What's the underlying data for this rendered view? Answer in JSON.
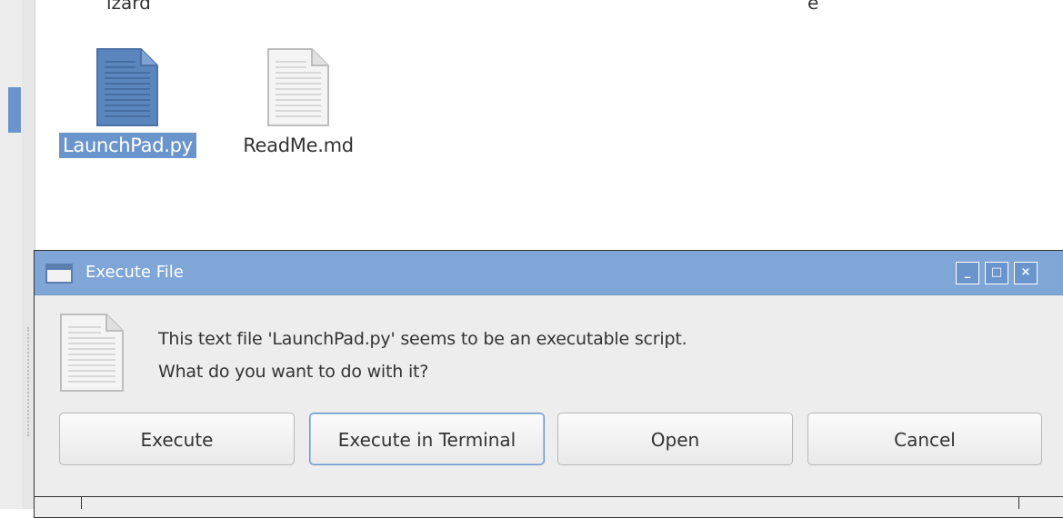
{
  "file_manager": {
    "truncated_labels": [
      "izard",
      "e"
    ],
    "files": [
      {
        "name": "LaunchPad.py",
        "selected": true,
        "icon": "text-file-icon"
      },
      {
        "name": "ReadMe.md",
        "selected": false,
        "icon": "text-file-icon"
      }
    ]
  },
  "dialog": {
    "title": "Execute File",
    "message_line1": "This text file 'LaunchPad.py' seems to be an executable script.",
    "message_line2": "What do you want to do with it?",
    "window_controls": {
      "minimize": "_",
      "maximize": "□",
      "close": "×"
    },
    "buttons": {
      "execute": "Execute",
      "execute_in_terminal": "Execute in Terminal",
      "open": "Open",
      "cancel": "Cancel"
    }
  },
  "colors": {
    "selection": "#6a95cc",
    "titlebar": "#7fa6d6",
    "dialog_bg": "#ededed"
  }
}
